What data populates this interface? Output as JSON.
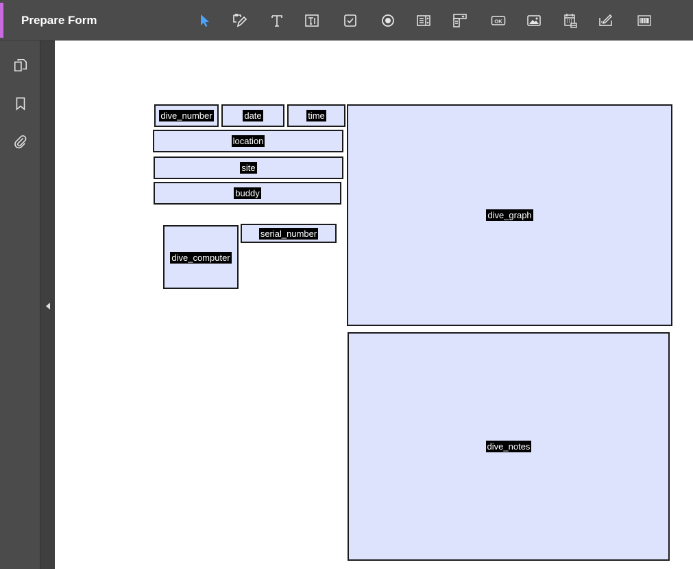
{
  "toolbar": {
    "title": "Prepare Form",
    "tools": [
      {
        "name": "select-tool",
        "icon": "pointer-arrow-icon"
      },
      {
        "name": "edit-tool",
        "icon": "edit-pen-icon"
      },
      {
        "name": "add-text-tool",
        "icon": "text-t-icon"
      },
      {
        "name": "text-field-tool",
        "icon": "text-field-icon"
      },
      {
        "name": "checkbox-tool",
        "icon": "checkbox-icon"
      },
      {
        "name": "radio-button-tool",
        "icon": "radio-button-icon"
      },
      {
        "name": "list-box-tool",
        "icon": "list-box-icon"
      },
      {
        "name": "dropdown-tool",
        "icon": "dropdown-icon"
      },
      {
        "name": "button-tool",
        "icon": "ok-button-icon"
      },
      {
        "name": "image-tool",
        "icon": "image-icon"
      },
      {
        "name": "date-field-tool",
        "icon": "calendar-icon"
      },
      {
        "name": "signature-tool",
        "icon": "signature-icon"
      },
      {
        "name": "barcode-tool",
        "icon": "barcode-icon"
      }
    ],
    "ok_label": "OK",
    "accent_color": "#c86be0",
    "select_color": "#4aa3ff"
  },
  "leftnav": {
    "items": [
      {
        "name": "pages-panel",
        "icon": "pages-copy-icon"
      },
      {
        "name": "bookmarks-panel",
        "icon": "bookmark-icon"
      },
      {
        "name": "attachments-panel",
        "icon": "paperclip-icon"
      }
    ]
  },
  "form": {
    "fill_color": "#dde3fc",
    "fields": [
      {
        "label": "dive_number"
      },
      {
        "label": "date"
      },
      {
        "label": "time"
      },
      {
        "label": "location"
      },
      {
        "label": "site"
      },
      {
        "label": "buddy"
      },
      {
        "label": "serial_number"
      },
      {
        "label": "dive_computer"
      },
      {
        "label": "dive_graph"
      },
      {
        "label": "dive_notes"
      }
    ]
  }
}
